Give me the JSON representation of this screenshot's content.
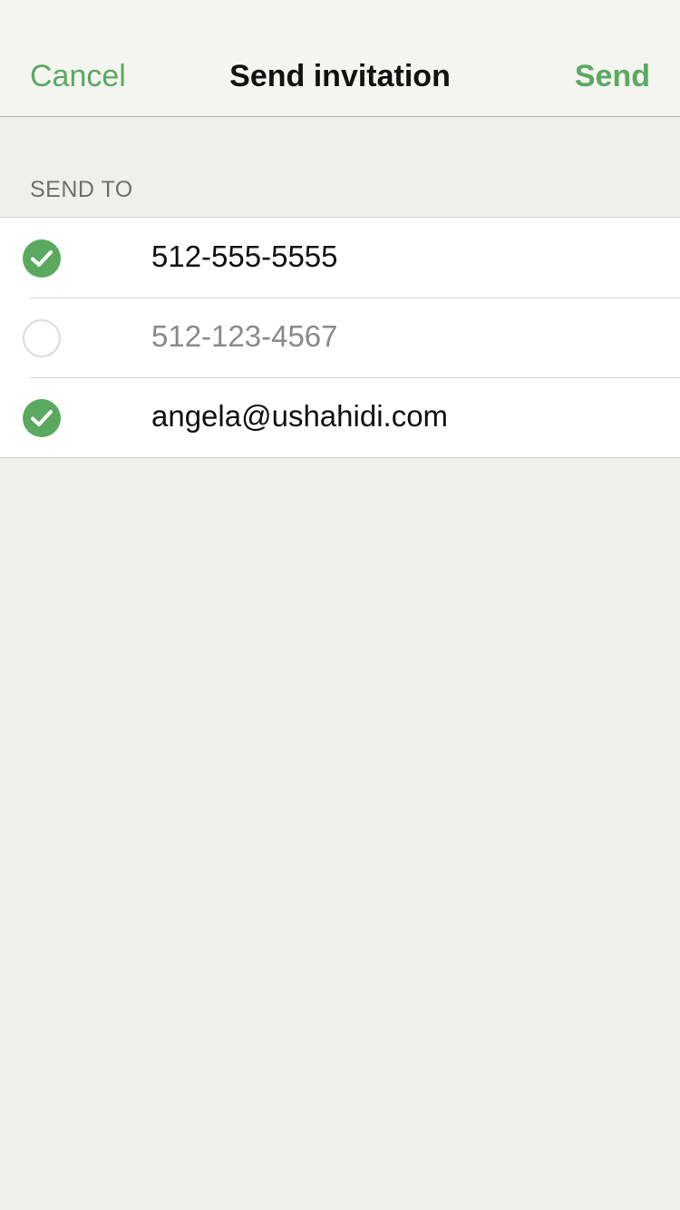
{
  "navbar": {
    "cancel_label": "Cancel",
    "title": "Send invitation",
    "send_label": "Send"
  },
  "section": {
    "header": "SEND TO"
  },
  "recipients": [
    {
      "value": "512-555-5555",
      "selected": true
    },
    {
      "value": "512-123-4567",
      "selected": false
    },
    {
      "value": "angela@ushahidi.com",
      "selected": true
    }
  ],
  "colors": {
    "accent": "#5aa95f",
    "background": "#efefeb",
    "navbar": "#f4f4f1"
  },
  "icons": {
    "selected": "checkmark-circle-icon",
    "unselected": "empty-circle-icon"
  }
}
